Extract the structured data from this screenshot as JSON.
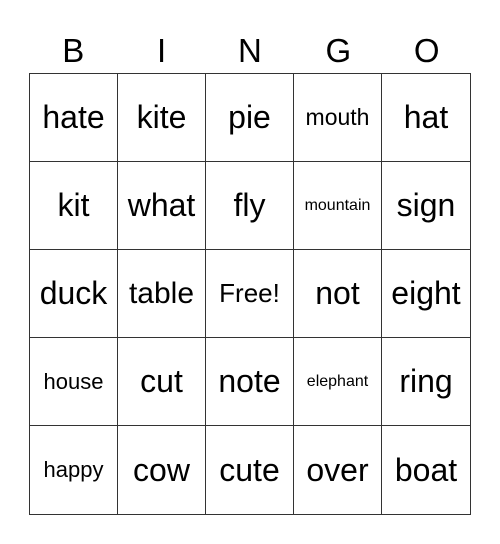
{
  "header": [
    "B",
    "I",
    "N",
    "G",
    "O"
  ],
  "cells": [
    "hate",
    "kite",
    "pie",
    "mouth",
    "hat",
    "kit",
    "what",
    "fly",
    "mountain",
    "sign",
    "duck",
    "table",
    "Free!",
    "not",
    "eight",
    "house",
    "cut",
    "note",
    "elephant",
    "ring",
    "happy",
    "cow",
    "cute",
    "over",
    "boat"
  ]
}
